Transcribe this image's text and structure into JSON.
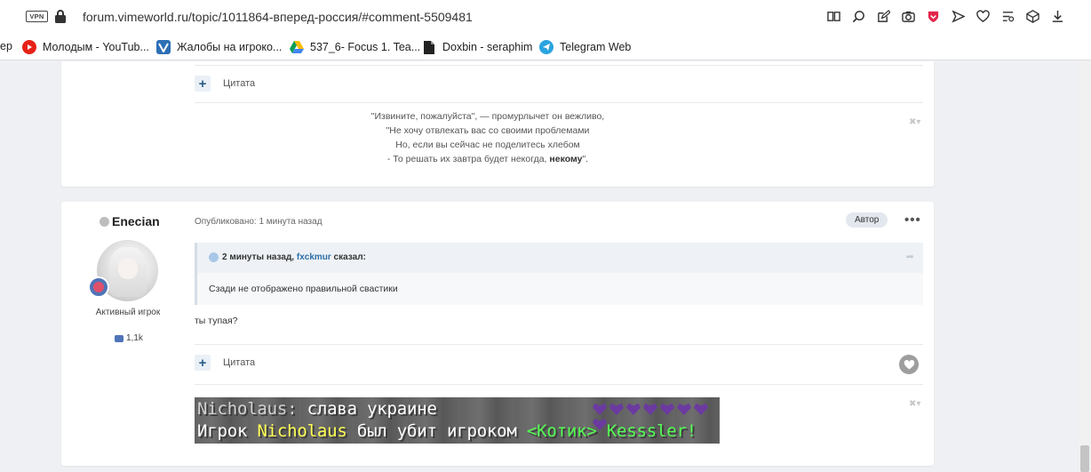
{
  "browser": {
    "vpn_label": "VPN",
    "url": "forum.vimeworld.ru/topic/1011864-вперед-россия/#comment-5509481",
    "toolbar_icons": [
      "reader-icon",
      "search-icon",
      "edit-icon",
      "camera-icon",
      "shield-icon",
      "send-icon",
      "heart-icon",
      "settings-icon",
      "box-icon",
      "download-icon"
    ]
  },
  "bookmarks": [
    {
      "label": "ер",
      "icon": "none"
    },
    {
      "label": "Молодым - YouTub...",
      "icon": "youtube-icon"
    },
    {
      "label": "Жалобы на игроко...",
      "icon": "vimeworld-icon"
    },
    {
      "label": "537_6- Focus 1. Tea...",
      "icon": "drive-icon"
    },
    {
      "label": "Doxbin - seraphim",
      "icon": "doc-icon"
    },
    {
      "label": "Telegram Web",
      "icon": "telegram-icon"
    }
  ],
  "prev_post": {
    "quote_label": "Цитата",
    "signature": {
      "line1": "\"Извините, пожалуйста\", — промурлычет он вежливо,",
      "line2": "\"Не хочу отвлекать вас со своими проблемами",
      "line3": "Но, если вы сейчас не поделитесь хлебом",
      "line4_start": "- То решать их завтра будет некогда, ",
      "line4_bold": "некому",
      "line4_end": "\"."
    }
  },
  "post": {
    "username": "Enecian",
    "user_title": "Активный игрок",
    "post_count": "1,1k",
    "meta": "Опубликовано: 1 минута назад",
    "author_badge": "Автор",
    "more_label": "•••",
    "quote": {
      "time": "2 минуты назад",
      "author": "fxckmur",
      "said": "сказал:",
      "text": "Сзади не отображено правильной свастики"
    },
    "reply": "ты тупая?",
    "quote_label": "Цитата"
  },
  "minecraft_chat": {
    "line1_name": "Nicholaus:",
    "line1_text": " слава украине",
    "line2_prefix": "Игрок ",
    "line2_name": "Nicholaus",
    "line2_mid": " был убит игроком ",
    "line2_killer": "<Котик> Kesssler!",
    "hearts": 8
  }
}
